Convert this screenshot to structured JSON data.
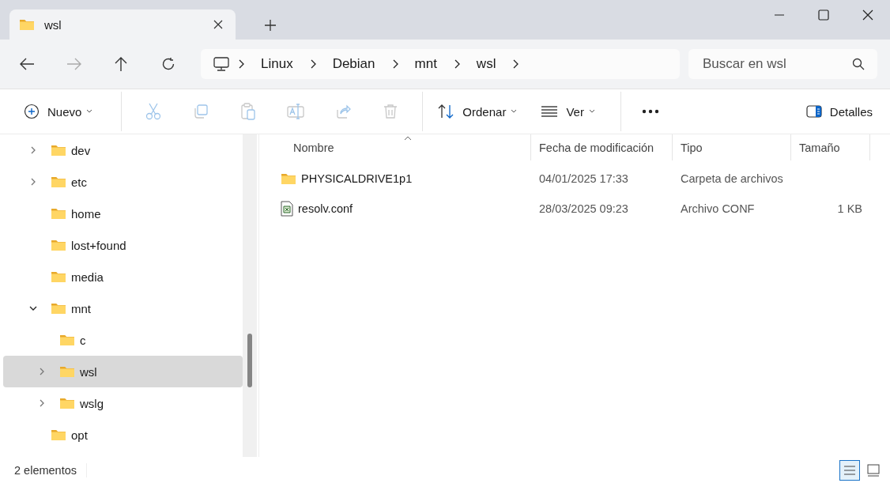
{
  "window": {
    "tab_title": "wsl"
  },
  "breadcrumb": [
    "Linux",
    "Debian",
    "mnt",
    "wsl"
  ],
  "search": {
    "placeholder": "Buscar en wsl"
  },
  "toolbar": [
    {
      "kind": "menu",
      "label": "Nuevo",
      "disabled": false
    },
    {
      "kind": "icon",
      "disabled": true
    },
    {
      "kind": "icon",
      "disabled": true
    },
    {
      "kind": "icon",
      "disabled": true
    },
    {
      "kind": "icon",
      "disabled": true
    },
    {
      "kind": "icon",
      "disabled": true
    },
    {
      "kind": "icon",
      "disabled": true
    },
    {
      "kind": "menu",
      "label": "Ordenar",
      "disabled": false
    },
    {
      "kind": "menu",
      "label": "Ver",
      "disabled": false
    },
    {
      "kind": "more",
      "disabled": false
    },
    {
      "kind": "details",
      "label": "Detalles",
      "disabled": false
    }
  ],
  "tree": [
    {
      "label": "dev",
      "expanded": false,
      "selected": false
    },
    {
      "label": "etc",
      "expanded": false,
      "selected": false
    },
    {
      "label": "home",
      "selected": false
    },
    {
      "label": "lost+found",
      "selected": false
    },
    {
      "label": "media",
      "selected": false
    },
    {
      "label": "mnt",
      "expanded": true,
      "selected": false,
      "children": [
        {
          "label": "c",
          "selected": false
        },
        {
          "label": "wsl",
          "expanded": false,
          "selected": true
        },
        {
          "label": "wslg",
          "expanded": false,
          "selected": false
        }
      ]
    },
    {
      "label": "opt",
      "selected": false
    }
  ],
  "table": {
    "columns": [
      "Nombre",
      "Fecha de modificación",
      "Tipo",
      "Tamaño"
    ],
    "rows": [
      {
        "kind": "folder",
        "name": "PHYSICALDRIVE1p1",
        "date": "04/01/2025 17:33",
        "type": "Carpeta de archivos"
      },
      {
        "kind": "file",
        "name": "resolv.conf",
        "date": "28/03/2025 09:23",
        "type": "Archivo CONF",
        "size": "1 KB"
      }
    ]
  },
  "status_bar": {
    "count": "2 elementos",
    "views": [
      {
        "kind": "details",
        "selected": true
      },
      {
        "kind": "tiles",
        "selected": false
      }
    ]
  }
}
